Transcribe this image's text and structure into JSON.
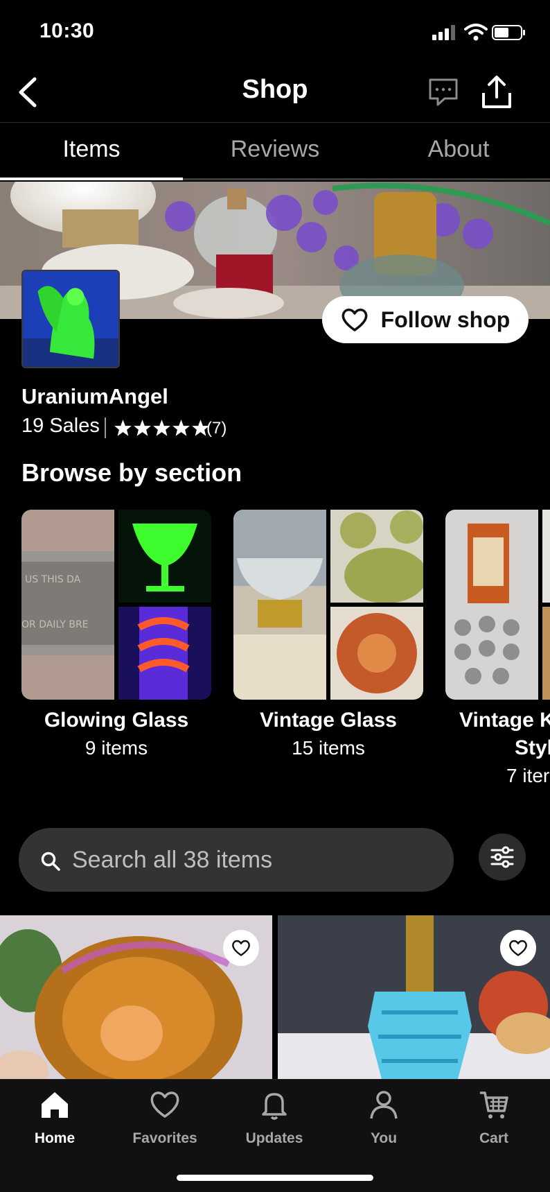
{
  "status_bar": {
    "time": "10:30"
  },
  "header": {
    "title": "Shop"
  },
  "tabs": [
    {
      "label": "Items",
      "active": true
    },
    {
      "label": "Reviews",
      "active": false
    },
    {
      "label": "About",
      "active": false
    }
  ],
  "shop": {
    "follow_label": "Follow shop",
    "name": "UraniumAngel",
    "sales": "19 Sales",
    "rating_stars": 5,
    "rating_count": "(7)"
  },
  "browse": {
    "title": "Browse by section",
    "sections": [
      {
        "title": "Glowing Glass",
        "count": "9 items"
      },
      {
        "title": "Vintage Glass",
        "count": "15 items"
      },
      {
        "title": "Vintage K",
        "title2": "Styl",
        "count": "7 iter"
      }
    ]
  },
  "search": {
    "placeholder": "Search all 38 items"
  },
  "bottom_nav": [
    {
      "label": "Home",
      "icon": "home-icon",
      "active": true
    },
    {
      "label": "Favorites",
      "icon": "heart-icon",
      "active": false
    },
    {
      "label": "Updates",
      "icon": "bell-icon",
      "active": false
    },
    {
      "label": "You",
      "icon": "person-icon",
      "active": false
    },
    {
      "label": "Cart",
      "icon": "cart-icon",
      "active": false
    }
  ],
  "colors": {
    "background": "#000000",
    "follow_button_bg": "#ffffff",
    "search_bg": "#333333"
  }
}
